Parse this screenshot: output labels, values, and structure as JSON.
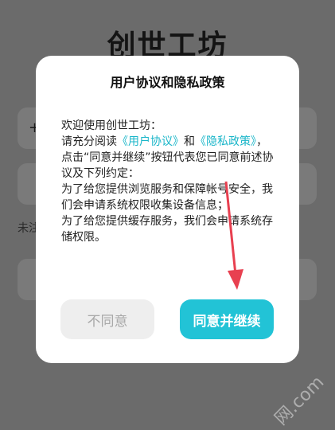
{
  "app": {
    "logo_text": "创世工坊"
  },
  "background": {
    "plus_symbol": "+",
    "partial_text": "未注"
  },
  "dialog": {
    "title": "用户协议和隐私政策",
    "body": {
      "line1": "欢迎使用创世工坊：",
      "pre_link": "请充分阅读",
      "user_agreement_link": "《用户协议》",
      "and_word": "和",
      "privacy_link": "《隐私政策》",
      "post_link": "，点击“同意并继续”按钮代表您已同意前述协议及下列约定：",
      "para2": "为了给您提供浏览服务和保障帐号安全，我们会申请系统权限收集设备信息；",
      "para3": "为了给您提供缓存服务，我们会申请系统存储权限。"
    },
    "decline_label": "不同意",
    "accept_label": "同意并继续"
  },
  "colors": {
    "accent": "#22c3d6",
    "link": "#1ab6c9",
    "arrow": "#e84050",
    "overlay": "#6b6b6b"
  },
  "watermark_text": "网.com"
}
